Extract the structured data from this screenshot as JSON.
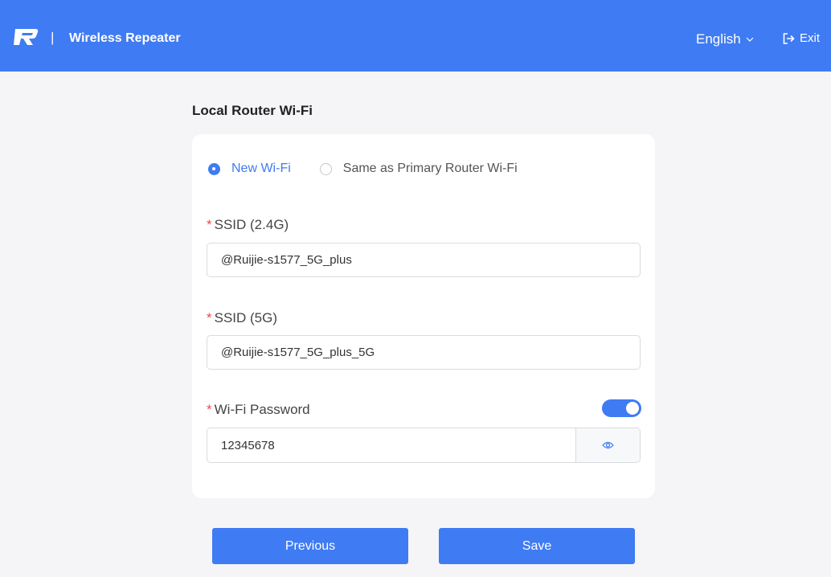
{
  "header": {
    "logo_icon": "ruijie-r-logo",
    "separator": "|",
    "title": "Wireless Repeater",
    "language": "English",
    "exit_label": "Exit",
    "accent_color": "#3f7bf3"
  },
  "section": {
    "title": "Local Router Wi-Fi"
  },
  "wifi_mode": {
    "options": [
      {
        "label": "New Wi-Fi",
        "selected": true
      },
      {
        "label": "Same as Primary Router Wi-Fi",
        "selected": false
      }
    ]
  },
  "fields": {
    "required_mark": "*",
    "ssid_24": {
      "label": "SSID (2.4G)",
      "value": "@Ruijie-s1577_5G_plus"
    },
    "ssid_5": {
      "label": "SSID (5G)",
      "value": "@Ruijie-s1577_5G_plus_5G"
    },
    "password": {
      "label": "Wi-Fi Password",
      "value": "12345678",
      "toggle_on": true,
      "reveal_icon": "eye-icon"
    }
  },
  "buttons": {
    "previous": "Previous",
    "save": "Save"
  }
}
